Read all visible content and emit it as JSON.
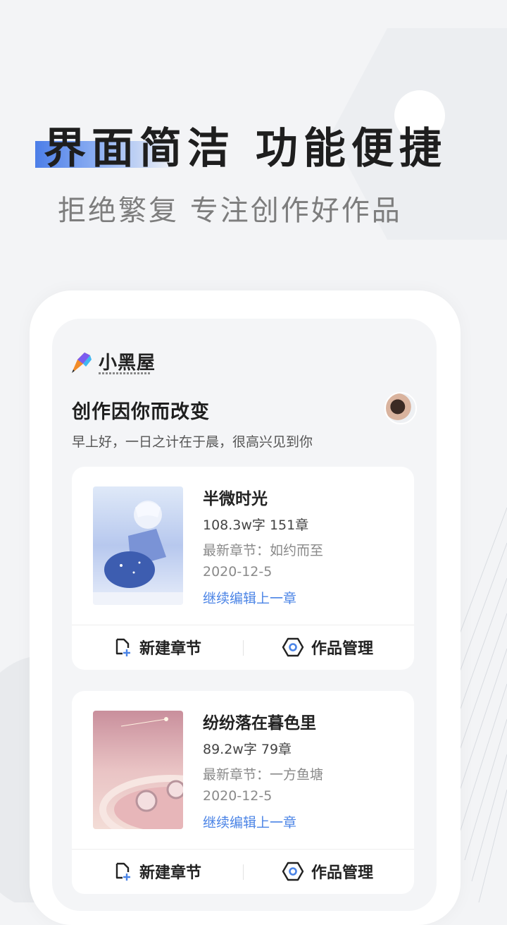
{
  "hero": {
    "title": "界面简洁 功能便捷",
    "subtitle": "拒绝繁复 专注创作好作品"
  },
  "app": {
    "logo_text": "小黑屋",
    "greeting_title": "创作因你而改变",
    "greeting_subtitle": "早上好，一日之计在于晨，很高兴见到你"
  },
  "books": [
    {
      "title": "半微时光",
      "stats": "108.3w字 151章",
      "latest": "最新章节：如约而至",
      "date": "2020-12-5",
      "continue_label": "继续编辑上一章",
      "new_chapter_label": "新建章节",
      "manage_label": "作品管理"
    },
    {
      "title": "纷纷落在暮色里",
      "stats": "89.2w字 79章",
      "latest": "最新章节：一方鱼塘",
      "date": "2020-12-5",
      "continue_label": "继续编辑上一章",
      "new_chapter_label": "新建章节",
      "manage_label": "作品管理"
    }
  ],
  "icons": {
    "logo": "pen-logo-icon",
    "new_chapter": "new-document-icon",
    "manage": "hexagon-settings-icon"
  },
  "colors": {
    "accent": "#4b84e6",
    "background": "#f3f4f6",
    "card": "#ffffff"
  }
}
